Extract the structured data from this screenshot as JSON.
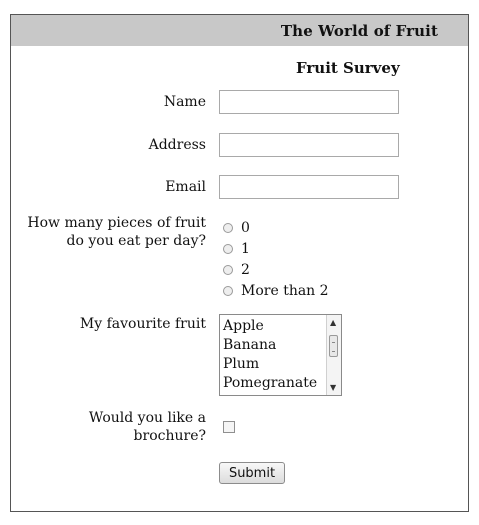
{
  "header": {
    "title": "The World of Fruit"
  },
  "form": {
    "title": "Fruit Survey",
    "name_label": "Name",
    "name_value": "",
    "address_label": "Address",
    "address_value": "",
    "email_label": "Email",
    "email_value": "",
    "fruit_count_label_line1": "How many pieces of fruit",
    "fruit_count_label_line2": "do you eat per day?",
    "fruit_count_options": [
      "0",
      "1",
      "2",
      "More than 2"
    ],
    "favourite_label": "My favourite fruit",
    "favourite_options": [
      "Apple",
      "Banana",
      "Plum",
      "Pomegranate"
    ],
    "brochure_label_line1": "Would you like a",
    "brochure_label_line2": "brochure?",
    "brochure_checked": false,
    "submit_label": "Submit"
  },
  "icons": {
    "scroll_up": "triangle-up",
    "scroll_down": "triangle-down"
  }
}
